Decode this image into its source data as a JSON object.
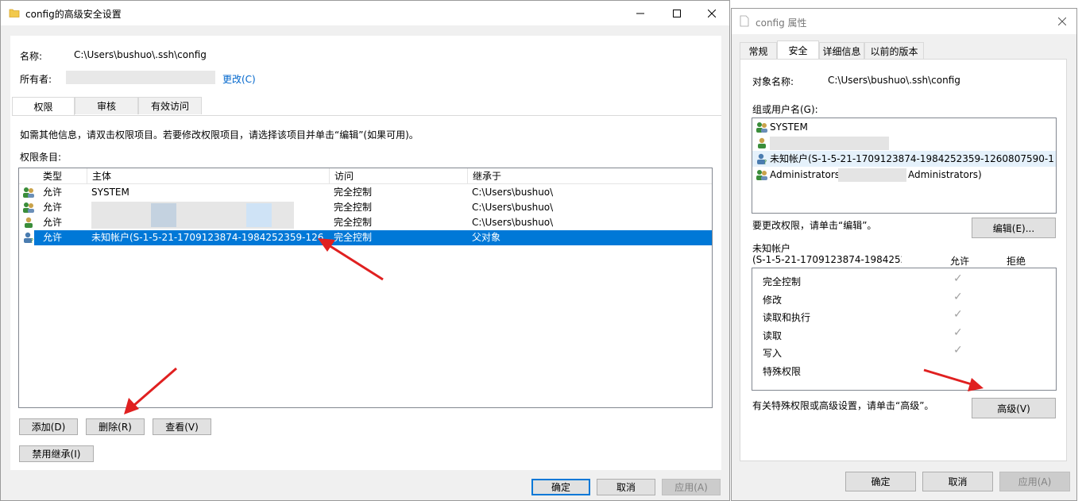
{
  "advanced": {
    "title": "config的高级安全设置",
    "name_label": "名称:",
    "name_value": "C:\\Users\\bushuo\\.ssh\\config",
    "owner_label": "所有者:",
    "owner_change": "更改(C)",
    "tabs": [
      "权限",
      "审核",
      "有效访问"
    ],
    "info_text": "如需其他信息，请双击权限项目。若要修改权限项目，请选择该项目并单击“编辑”(如果可用)。",
    "entries_label": "权限条目:",
    "columns": [
      "类型",
      "主体",
      "访问",
      "继承于"
    ],
    "rows": [
      {
        "type": "允许",
        "principal": "SYSTEM",
        "access": "完全控制",
        "inherit": "C:\\Users\\bushuo\\"
      },
      {
        "type": "允许",
        "principal": "",
        "access": "完全控制",
        "inherit": "C:\\Users\\bushuo\\"
      },
      {
        "type": "允许",
        "principal": "",
        "access": "完全控制",
        "inherit": "C:\\Users\\bushuo\\"
      },
      {
        "type": "允许",
        "principal": "未知帐户(S-1-5-21-1709123874-1984252359-126...",
        "access": "完全控制",
        "inherit": "父对象"
      }
    ],
    "buttons": {
      "add": "添加(D)",
      "remove": "删除(R)",
      "view": "查看(V)",
      "disable_inherit": "禁用继承(I)"
    },
    "footer": {
      "ok": "确定",
      "cancel": "取消",
      "apply": "应用(A)"
    }
  },
  "props": {
    "title": "config 属性",
    "tabs": [
      "常规",
      "安全",
      "详细信息",
      "以前的版本"
    ],
    "object_label": "对象名称:",
    "object_value": "C:\\Users\\bushuo\\.ssh\\config",
    "group_label": "组或用户名(G):",
    "users": [
      "SYSTEM",
      "",
      "未知帐户(S-1-5-21-1709123874-1984252359-1260807590-1...",
      "Administrators",
      "Administrators)"
    ],
    "change_text": "要更改权限，请单击“编辑”。",
    "edit_button": "编辑(E)...",
    "perm_for_line1": "未知帐户",
    "perm_for_line2": "(S-1-5-21-1709123874-1984252",
    "allow_label": "允许",
    "deny_label": "拒绝",
    "permissions": [
      "完全控制",
      "修改",
      "读取和执行",
      "读取",
      "写入",
      "特殊权限"
    ],
    "special_text": "有关特殊权限或高级设置，请单击“高级”。",
    "advanced_button": "高级(V)",
    "footer": {
      "ok": "确定",
      "cancel": "取消",
      "apply": "应用(A)"
    }
  },
  "colors": {
    "accent": "#0078d7",
    "annotation": "#e02020",
    "link": "#0066cc"
  }
}
